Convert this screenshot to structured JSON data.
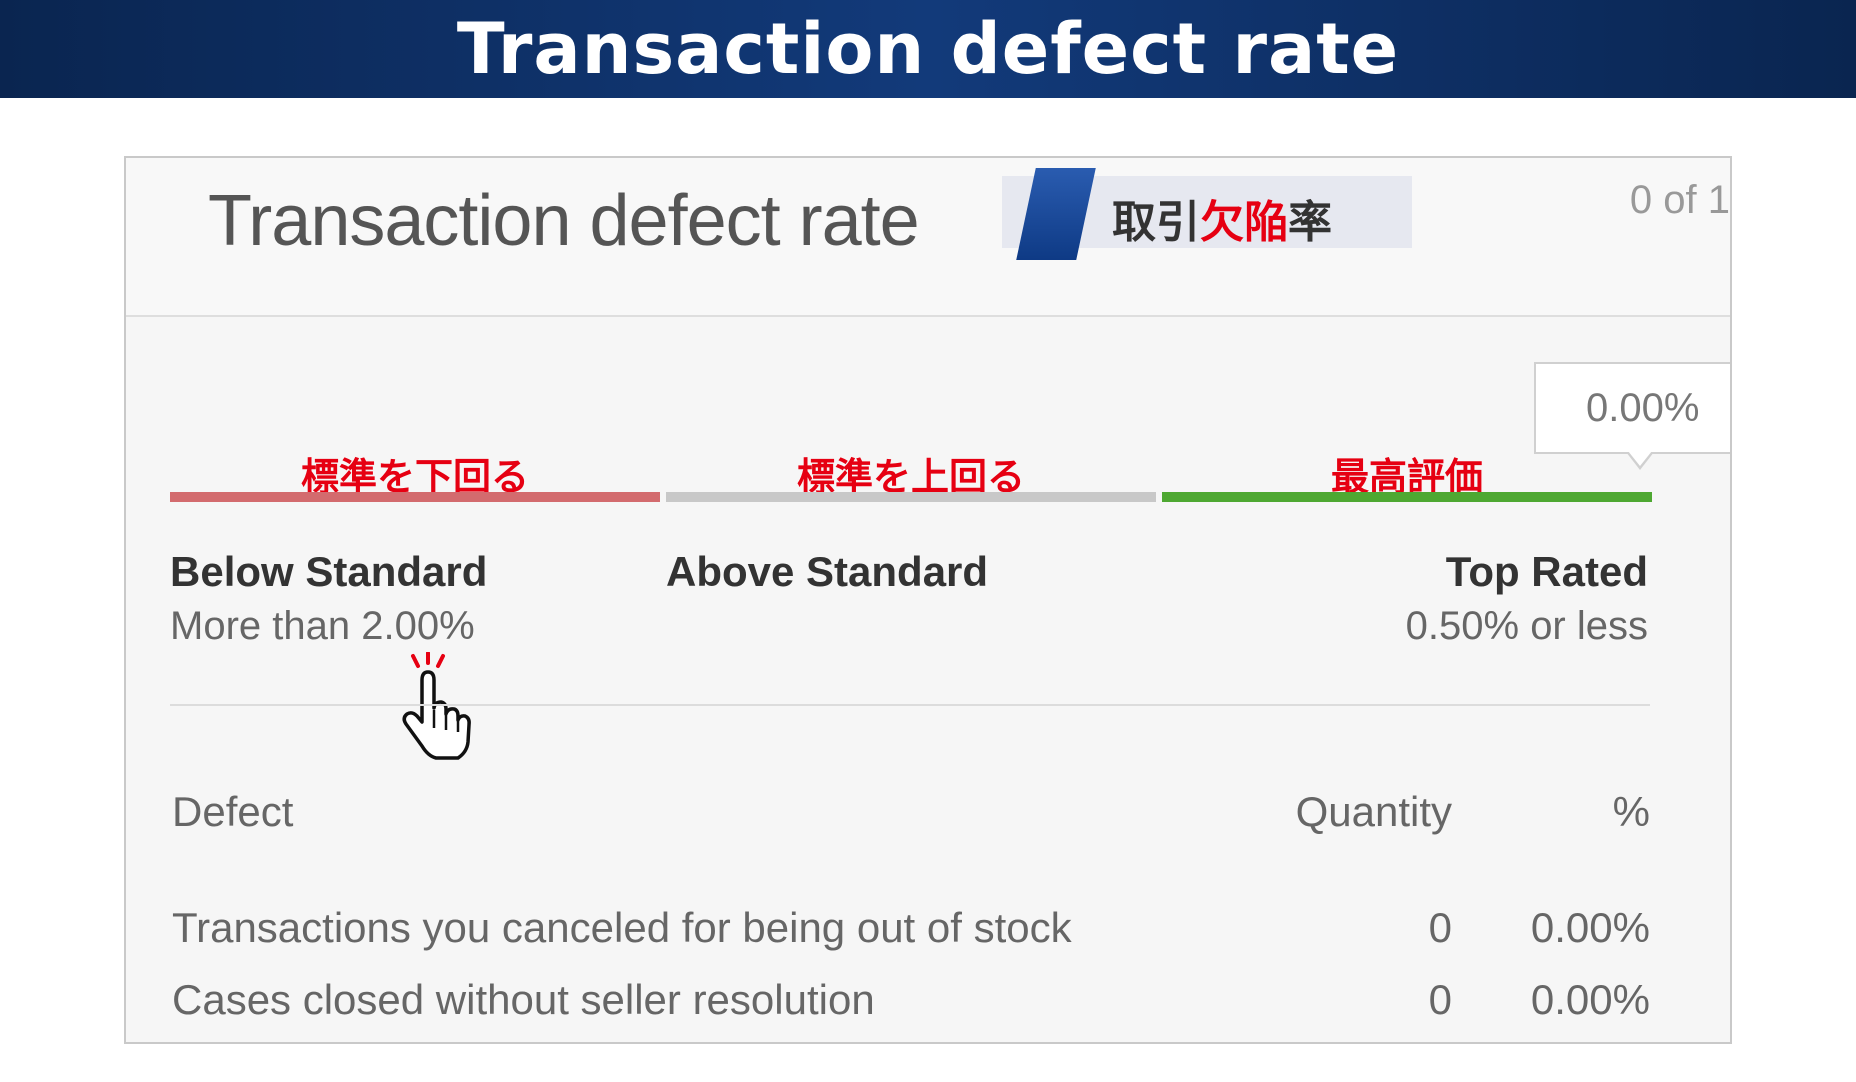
{
  "banner": {
    "title": "Transaction defect rate"
  },
  "panel": {
    "title": "Transaction defect rate",
    "page_count": "0 of 1",
    "jp_badge": {
      "part1": "取引",
      "part2": "欠陥",
      "part3": "率"
    }
  },
  "tooltip": {
    "value": "0.00%"
  },
  "tiers": [
    {
      "jp_label": "標準を下回る",
      "name": "Below Standard",
      "desc": "More than 2.00%",
      "color": "#d36b6e"
    },
    {
      "jp_label": "標準を上回る",
      "name": "Above Standard",
      "desc": "",
      "color": "#c8c8c8"
    },
    {
      "jp_label": "最高評価",
      "name": "Top Rated",
      "desc": "0.50% or less",
      "color": "#4ea832"
    }
  ],
  "table": {
    "headers": {
      "defect": "Defect",
      "quantity": "Quantity",
      "percent": "%"
    },
    "rows": [
      {
        "defect": "Transactions you canceled for being out of stock",
        "quantity": "0",
        "percent": "0.00%"
      },
      {
        "defect": "Cases closed without seller resolution",
        "quantity": "0",
        "percent": "0.00%"
      }
    ]
  },
  "icons": {
    "pointer": "hand-pointer-icon"
  }
}
